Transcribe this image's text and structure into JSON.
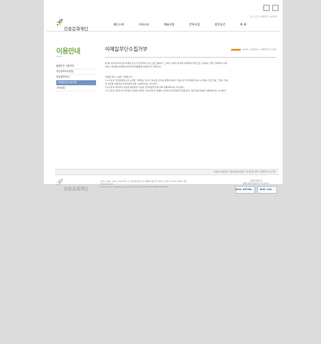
{
  "site": {
    "logo_text": "강릉문화재단",
    "util_links": "홈 | 로그인 | 회원가입 | 사이트맵"
  },
  "gnb": [
    "재단소개",
    "커뮤니티",
    "예술지원",
    "문화사업",
    "창작공간",
    "축 제"
  ],
  "lnb": {
    "title": "이용안내",
    "subtitle": "Guide",
    "items": [
      "홈페이지 이용약관",
      "개인정보처리방침",
      "영상정보처리",
      "이메일무단수집거부",
      "사이트맵"
    ],
    "active_index": 3
  },
  "content": {
    "title": "이메일무단수집거부",
    "breadcrumb": "HOME > 이용안내 > 이메일무단수집거부",
    "intro": [
      "본 웹 사이트에 게시된 이메일 주소가 전자우편 수집 프로그램이나 그 밖의 기술적 장치를 이용하여 무단으로 수집되는 것을 거부하며, 이를",
      "위반시 정보통신망법에 의해 형사처벌됨을 유념하시기 바랍니다."
    ],
    "law_title": "이메일 무단 수집할 거부합니다",
    "law_lines": [
      "1.누구든지 전자우편주소의 수집을 거부하는 의사가 명시된 인터넷 홈페이지에서 자동으로 전자우편주소를 수집하는 프로그램 그 밖의 기술",
      "적 장치를 이용하여 전자우편주소를 수집하여서는 아니된다.",
      "2.누구든지 제1항의 규정을 위반하여 수집된 전자우편주소를 판매 유통하여서는 아니된다.",
      "3.누구든지 제1항 및 제2항의 규정에 의하여 수집·판매 및 유통이 금지된 전자우편주소임을 알고 이를 정보전송에 이용하여서는 아니된다."
    ]
  },
  "footer": {
    "nav": "홈페이지 이용약관  |  개인정보처리방침  |  웹 접근성 정책  |  이메일무단수집거부",
    "logo_text": "강릉문화재단",
    "address": "강원도 강릉시 경강로 2021번길 (구) 명주예술마당 내 강릉문화재단(우)우편 번 전화 033-647-6800, 팩스",
    "fax": "033-647-6801",
    "copyright": "Copyright by GangNeung Culture & Arts Foundation All Right Reserved.",
    "cert_line1": "강릉문화재단은",
    "cert_line2": "웹접근성과 웹표준을 준수합니다.",
    "badges": [
      "W3C XHTML",
      "W3C CSS"
    ]
  },
  "colors": {
    "accent_green": "#7aa84a",
    "active_blue": "#6f93c4",
    "crumb_orange": "#f19a3e",
    "background": "#dcdcdc"
  }
}
